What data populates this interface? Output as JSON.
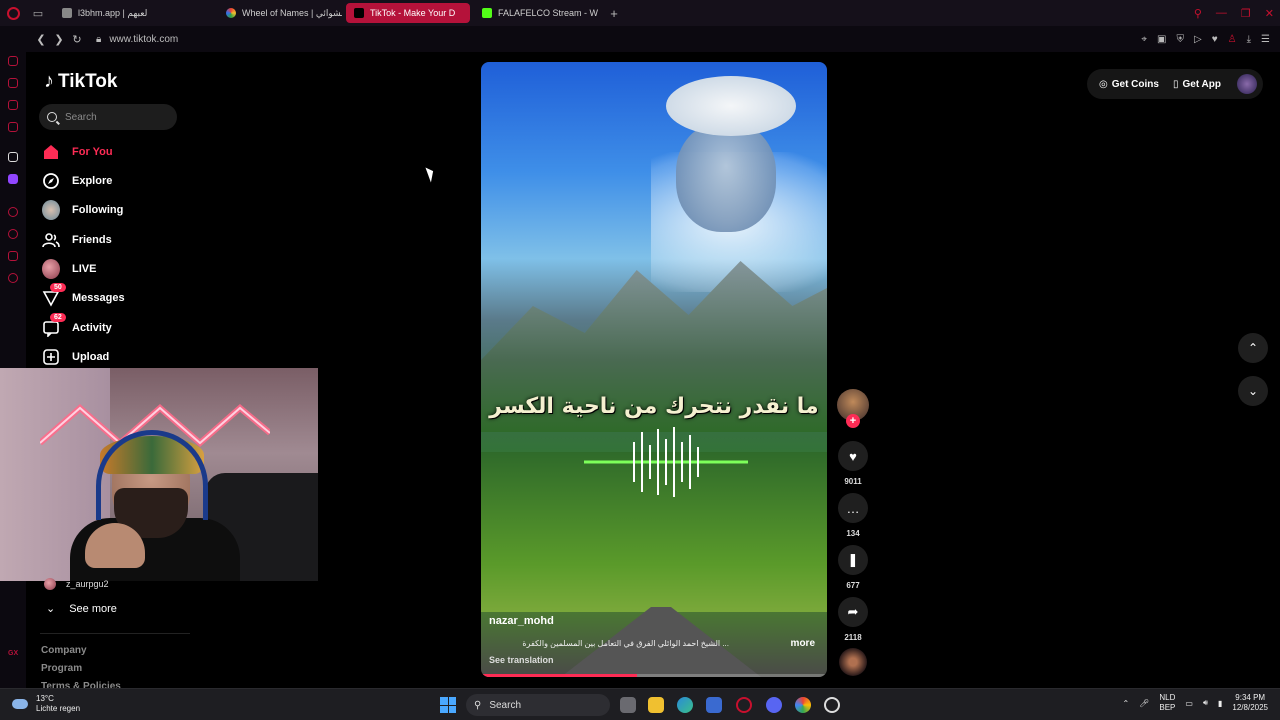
{
  "browser": {
    "tabs": [
      {
        "label": "l3bhm.app | لعبهم",
        "active": false,
        "color": "#d0d0d0"
      },
      {
        "label": "Wheel of Names | عشوائي",
        "active": false,
        "color": "#f0a030"
      },
      {
        "label": "TikTok - Make Your D",
        "active": true,
        "color": "#ffffff"
      },
      {
        "label": "FALAFELCO Stream - Wa",
        "active": false,
        "color": "#53fc18"
      }
    ],
    "new_tab": "+",
    "url": "www.tiktok.com"
  },
  "tiktok": {
    "logo_text": "TikTok",
    "search_placeholder": "Search",
    "nav": [
      {
        "label": "For You",
        "icon": "home-icon",
        "active": true
      },
      {
        "label": "Explore",
        "icon": "compass-icon",
        "active": false
      },
      {
        "label": "Following",
        "icon": "following-avatar-icon",
        "active": false
      },
      {
        "label": "Friends",
        "icon": "friends-icon",
        "active": false
      },
      {
        "label": "LIVE",
        "icon": "live-avatar-icon",
        "active": false
      },
      {
        "label": "Messages",
        "icon": "messages-icon",
        "active": false,
        "badge": "50"
      },
      {
        "label": "Activity",
        "icon": "activity-icon",
        "active": false,
        "badge": "62"
      },
      {
        "label": "Upload",
        "icon": "upload-icon",
        "active": false
      }
    ],
    "following_user": "z_aurpgu2",
    "see_more": "See more",
    "footer_links": [
      "Company",
      "Program",
      "Terms & Policies"
    ],
    "accent_color": "#fe2c55"
  },
  "video": {
    "overlay_text": "ما نقدر نتحرك من ناحية الكسر",
    "author": "nazar_mohd",
    "caption": "... الشيخ احمد الوائلي الفرق في التعامل بين المسلمين والكفرة",
    "more": "more",
    "see_translation": "See translation",
    "progress": 0.45
  },
  "actions": {
    "likes": "9011",
    "comments": "134",
    "saves": "677",
    "shares": "2118"
  },
  "header_right": {
    "get_coins": "Get Coins",
    "get_app": "Get App"
  },
  "taskbar": {
    "temperature": "13°C",
    "weather": "Lichte regen",
    "search": "Search",
    "lang_top": "NLD",
    "lang_bottom": "BEP",
    "time": "9:34 PM",
    "date": "12/8/2025"
  }
}
